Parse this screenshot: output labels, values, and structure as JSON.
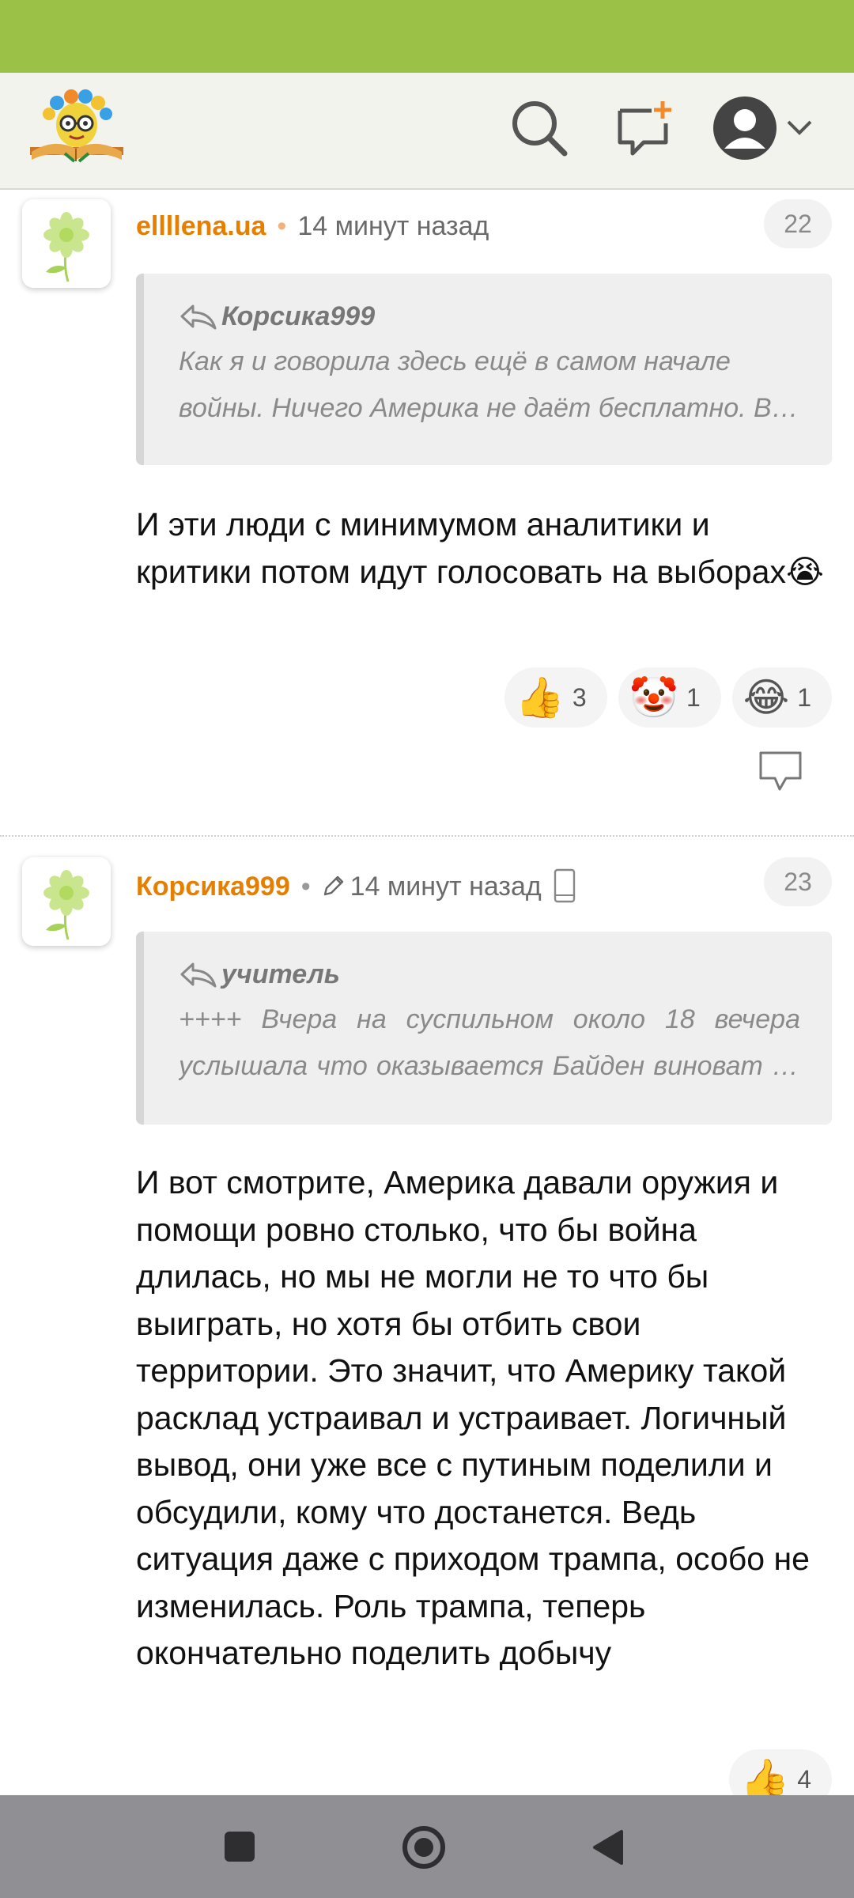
{
  "colors": {
    "status_bar": "#9bc146",
    "author": "#e67e00",
    "app_bar": "#f3f3ee",
    "nav_bar": "#8f8f94"
  },
  "header": {
    "icons": [
      "logo-icon",
      "search-icon",
      "new-message-icon",
      "profile-avatar-icon",
      "chevron-down-icon"
    ]
  },
  "comments": [
    {
      "author": "ellllena.ua",
      "time": "14 минут назад",
      "number": "22",
      "quote": {
        "author": "Корсика999",
        "text": "Как я и говорила здесь ещё в самом начале войны. Ничего Америка не даёт бесплатно. Всё имеет свою цену"
      },
      "body": "И эти люди с минимумом аналитики и критики потом идут голосовать на выборах😭",
      "reactions": [
        {
          "emoji": "👍",
          "count": "3"
        },
        {
          "emoji": "🤡",
          "count": "1"
        },
        {
          "emoji": "😂",
          "count": "1"
        }
      ]
    },
    {
      "author": "Корсика999",
      "time": "14 минут назад",
      "number": "23",
      "quote": {
        "author": "учитель",
        "text": "++++ Вчера на суспильном около 18 вечера услышала что оказывается Байден виноват во всём"
      },
      "body": "И вот смотрите, Америка давали оружия и помощи ровно столько, что бы война длилась, но мы не могли не то что бы выиграть, но хотя бы отбить свои территории. Это значит, что Америку такой расклад устраивал и устраивает. Логичный вывод, они уже все с путиным поделили и обсудили, кому что достанется. Ведь ситуация даже с приходом трампа, особо не изменилась. Роль трампа, теперь окончательно поделить добычу",
      "reactions": [
        {
          "emoji": "👍",
          "count": "4"
        }
      ]
    }
  ]
}
